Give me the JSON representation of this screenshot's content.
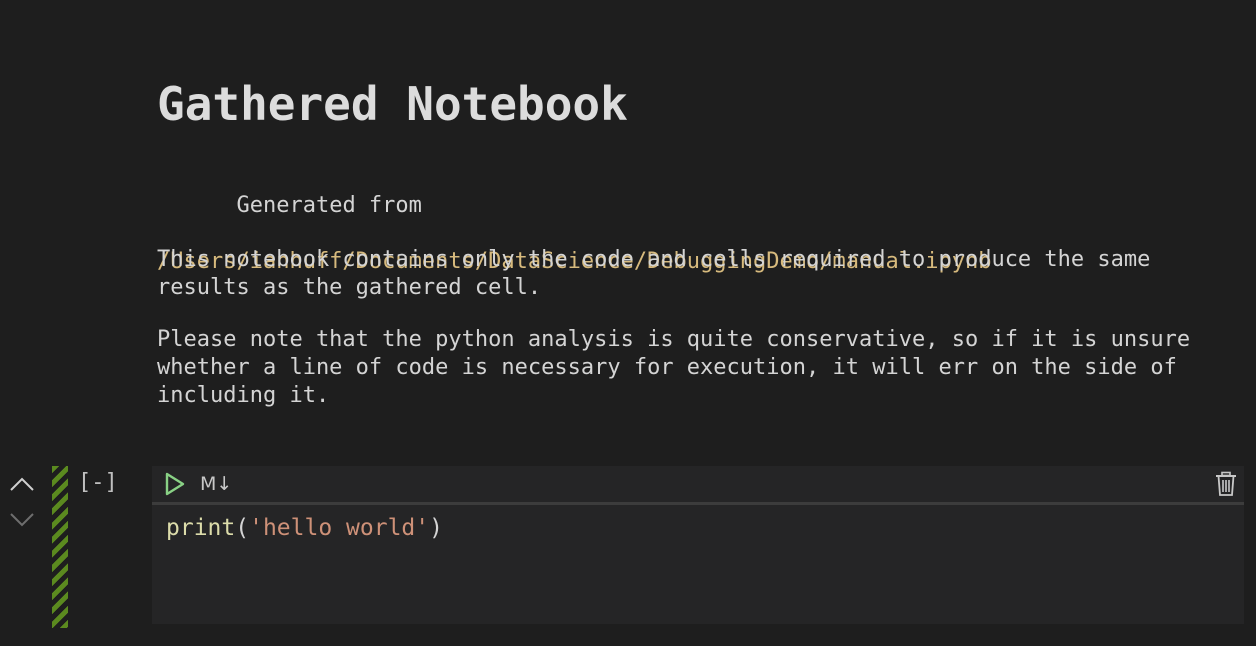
{
  "notebook": {
    "title": "Gathered Notebook",
    "generated_prefix": "Generated from",
    "source_path": "/Users/ianhuff/Documents/DataScience/DebuggingDemo/manual.ipynb",
    "paragraph1": "This notebook contains only the code and cells required to produce the same results as the gathered cell.",
    "paragraph2": "Please note that the python analysis is quite conservative, so if it is unsure whether a line of code is necessary for execution, it will err on the side of including it."
  },
  "cell": {
    "execution_count": "[-]",
    "markdown_toggle": "M↓",
    "code": {
      "function": "print",
      "open_paren": "(",
      "string": "'hello world'",
      "close_paren": ")"
    }
  },
  "icons": {
    "move_up": "chevron-up-icon",
    "move_down": "chevron-down-icon",
    "run": "play-icon",
    "delete": "trash-icon"
  },
  "colors": {
    "background": "#1e1e1e",
    "cell_background": "#252526",
    "link": "#d7ba7d",
    "run_icon": "#89d185",
    "stripe": "#5b8a1f",
    "string_token": "#ce9178",
    "function_token": "#dcdcaa"
  }
}
